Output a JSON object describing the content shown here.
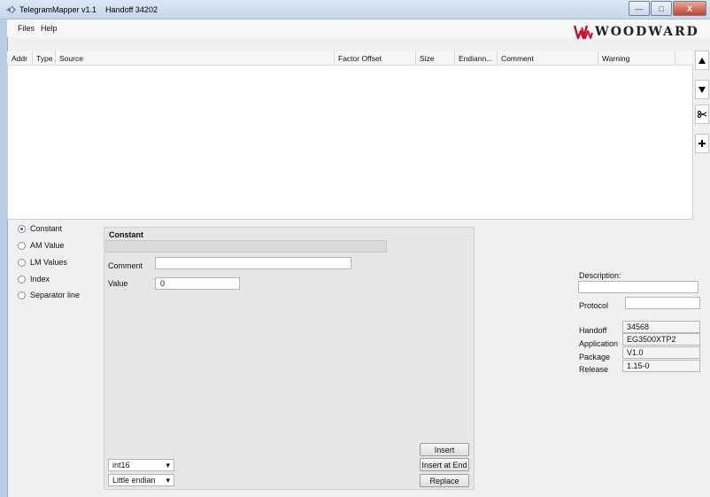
{
  "window": {
    "app_title": "TelegramMapper v1.1",
    "doc_title": "Handoff 34202",
    "close_glyph": "X"
  },
  "menu": {
    "files": "Files",
    "help": "Help"
  },
  "brand": {
    "logo_text": "WOODWARD",
    "color": "#c8102e"
  },
  "table": {
    "columns": [
      "Addr",
      "Type",
      "Source",
      "Factor Offset",
      "Size",
      "Endiann...",
      "Comment",
      "Warning"
    ]
  },
  "side_toolbar": {
    "icons": [
      "move-up-icon",
      "move-down-icon",
      "scissors-icon",
      "add-icon"
    ]
  },
  "source_types": {
    "options": [
      "Constant",
      "AM Value",
      "LM Values",
      "Index",
      "Separator line"
    ],
    "selected": "Constant"
  },
  "constant": {
    "title": "Constant",
    "comment_label": "Comment",
    "comment_value": "",
    "value_label": "Value",
    "value": "0",
    "data_type": "int16",
    "endianness": "Little endian",
    "insert_label": "Insert",
    "insert_end_label": "Insert at End",
    "replace_label": "Replace"
  },
  "info": {
    "description_label": "Description:",
    "description_value": "",
    "protocol_label": "Protocol",
    "protocol_value": "",
    "handoff_label": "Handoff",
    "handoff_value": "34568",
    "application_label": "Application",
    "application_value": "EG3500XTP2",
    "package_label": "Package",
    "package_value": "V1.0",
    "release_label": "Release",
    "release_value": "1.15-0"
  }
}
